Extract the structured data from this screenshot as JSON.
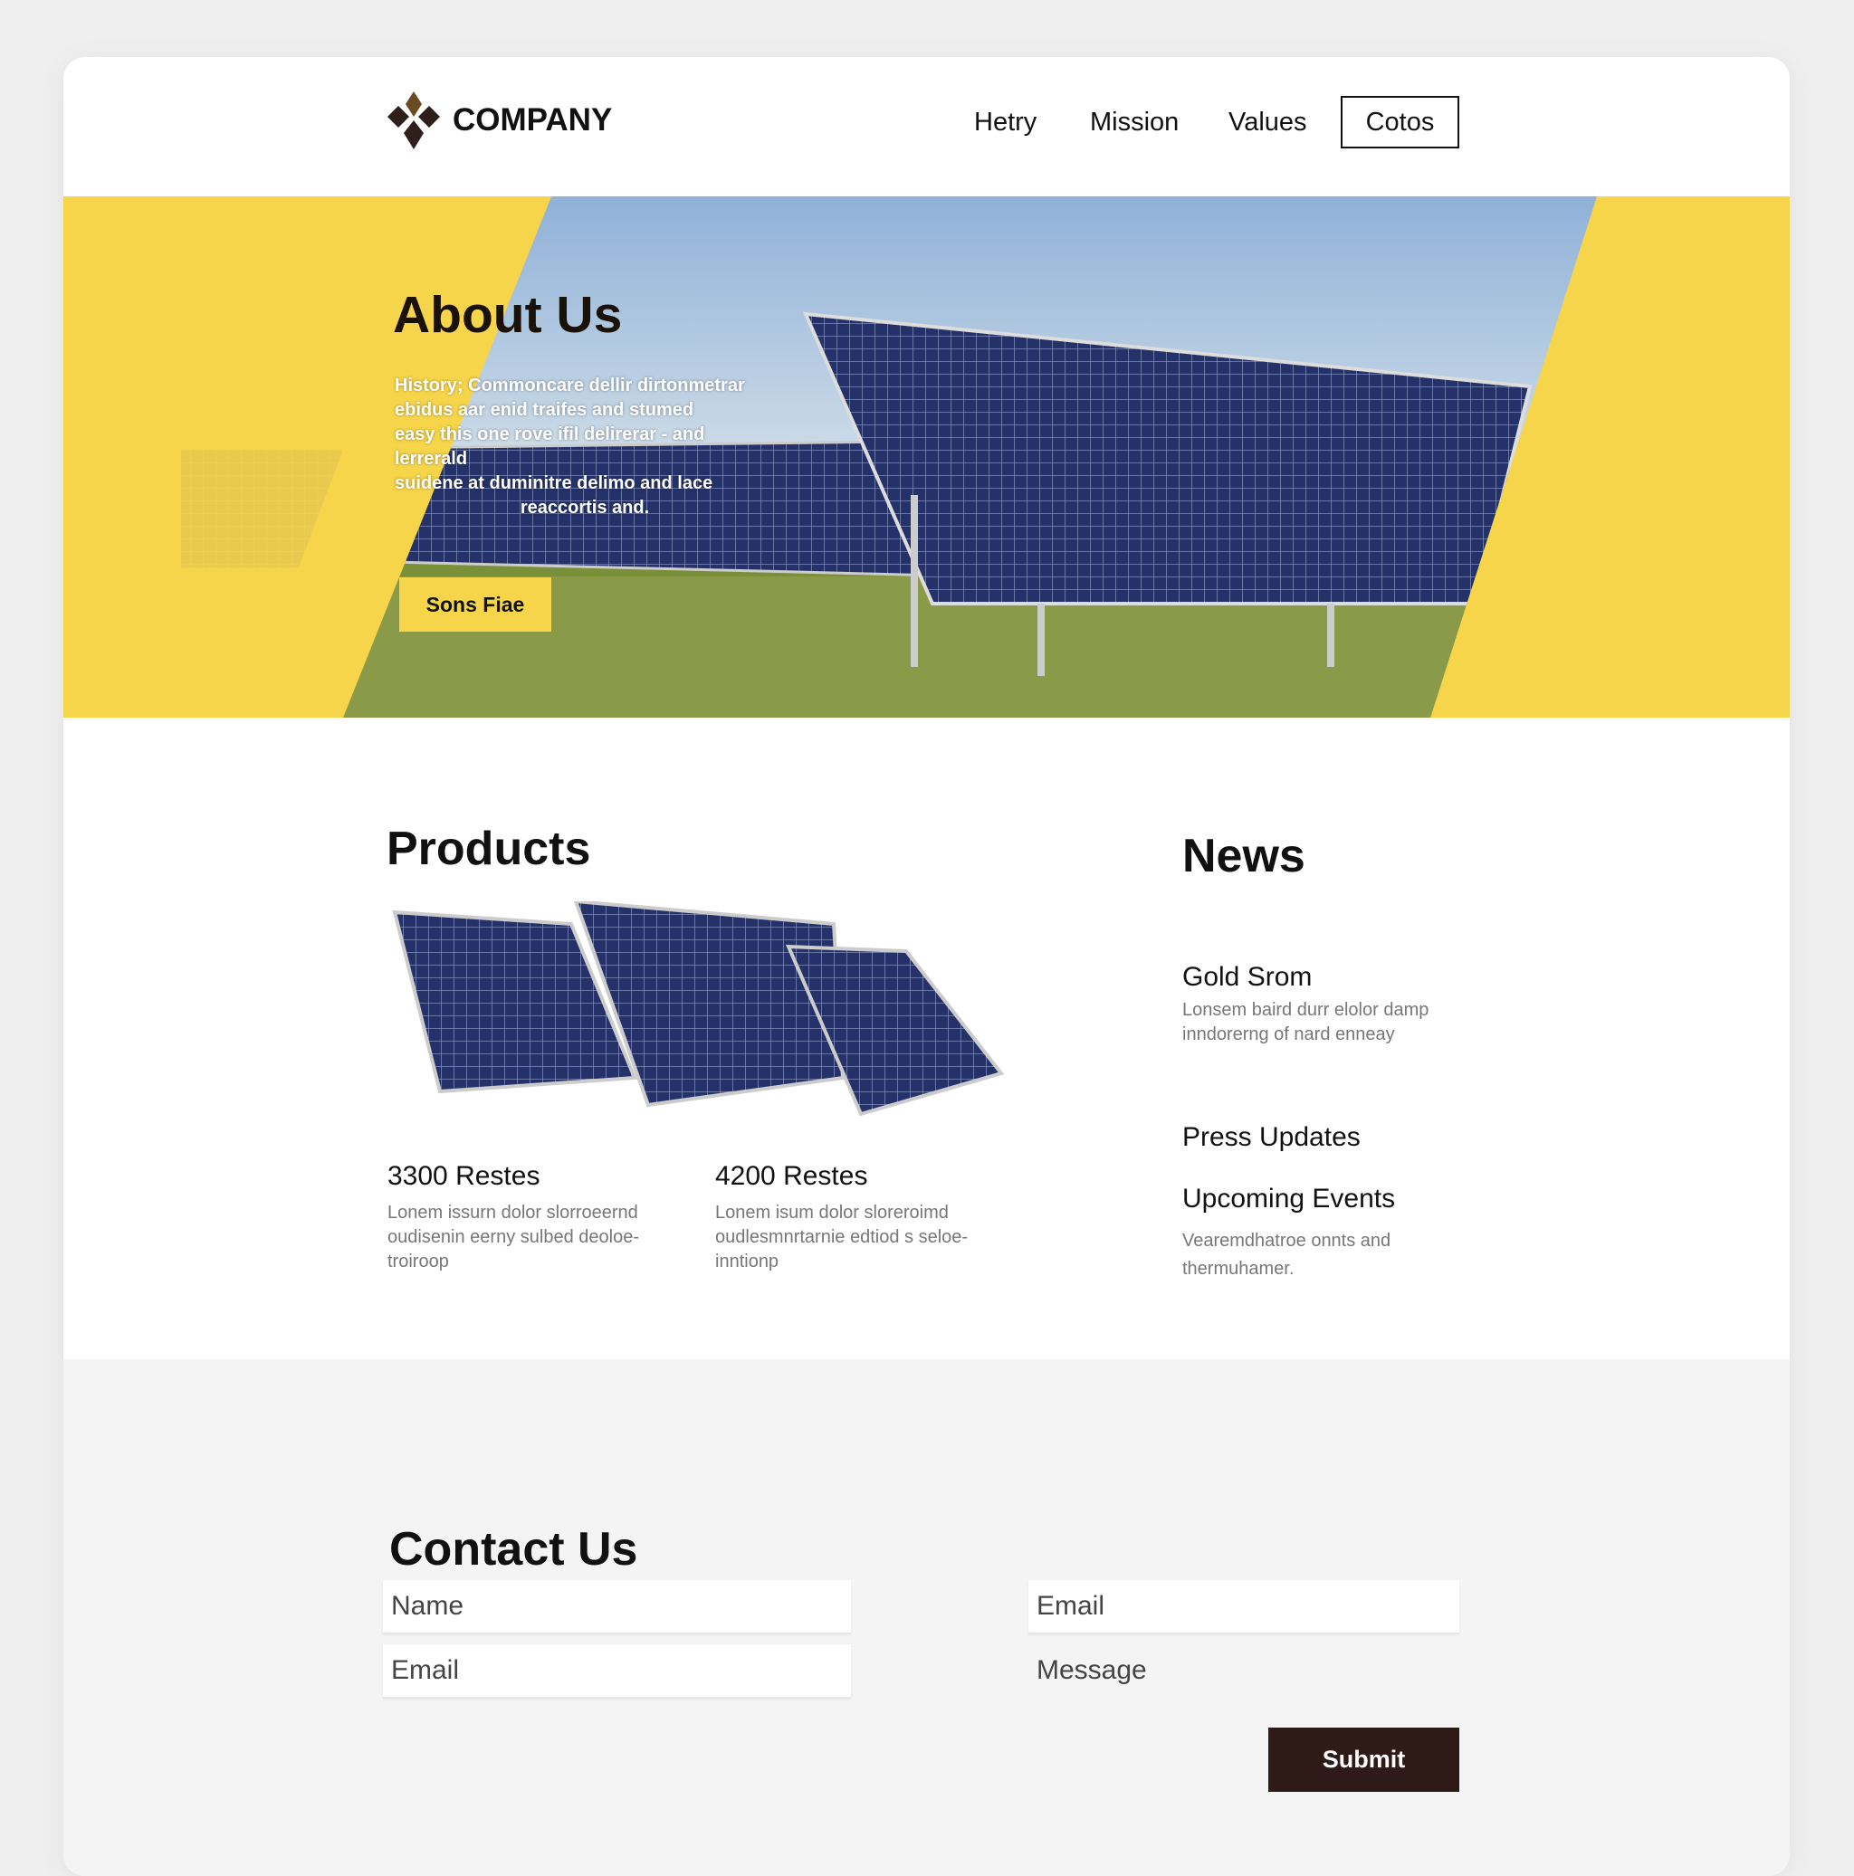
{
  "header": {
    "brand": "COMPANY",
    "nav": [
      "Hetry",
      "Mission",
      "Values"
    ],
    "nav_cta": "Cotos"
  },
  "hero": {
    "title": "About Us",
    "paragraph": [
      "History; Commoncare dellir dirtonmetrar",
      "ebidus aar enid traifes and stumed",
      "easy this one rove ifil delirerar - and lerrerald",
      "suidene at duminitre delimo and lace",
      "reaccortis and."
    ],
    "button": "Sons Fiae"
  },
  "products": {
    "title": "Products",
    "items": [
      {
        "title": "3300 Restes",
        "desc": "Lonem issurn dolor slorroeernd oudisenin eerny sulbed deoloe-troiroop"
      },
      {
        "title": "4200 Restes",
        "desc": "Lonem isum dolor sloreroimd oudlesmnrtarnie edtiod s seloe-inntionp"
      }
    ]
  },
  "news": {
    "title": "News",
    "items": [
      {
        "title": "Gold Srom",
        "desc": "Lonsem baird durr elolor damp inndorerng of nard enneay"
      },
      {
        "title": "Press Updates",
        "desc": ""
      },
      {
        "title": "Upcoming Events",
        "desc": "Vearemdhatroe onnts and thermuhamer."
      }
    ]
  },
  "contact": {
    "title": "Contact Us",
    "name_placeholder": "Name",
    "email_placeholder": "Email",
    "email2_placeholder": "Email",
    "message_placeholder": "Message",
    "submit": "Submit"
  },
  "colors": {
    "accent": "#f7d54a",
    "dark": "#2e1a17"
  }
}
